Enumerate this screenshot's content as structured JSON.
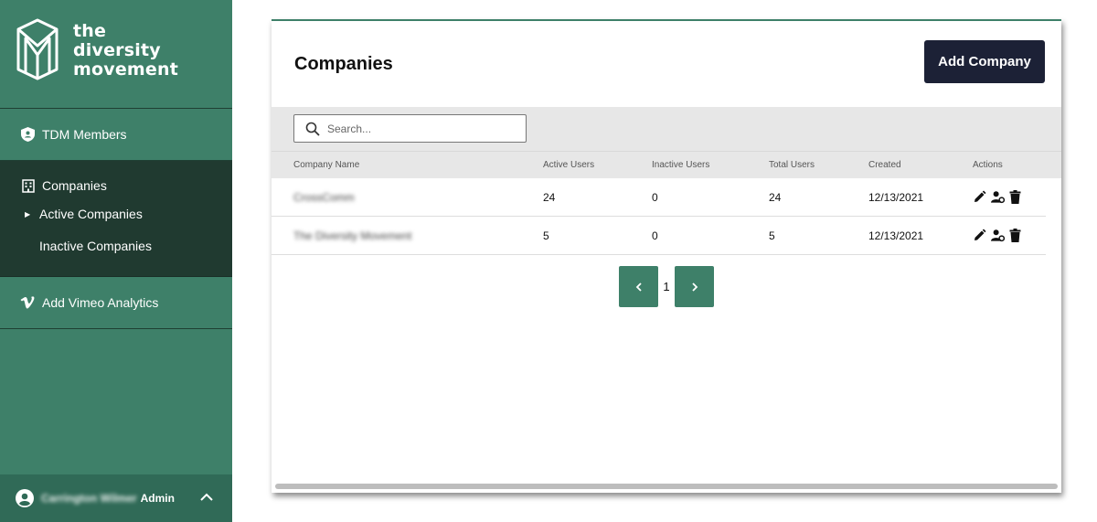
{
  "brand": {
    "line1": "the",
    "line2": "diversity",
    "line3": "movement",
    "color": "#3e8069"
  },
  "sidebar": {
    "tdm_members": "TDM Members",
    "companies": "Companies",
    "active_companies": "Active Companies",
    "inactive_companies": "Inactive Companies",
    "vimeo": "Add Vimeo Analytics",
    "user_name": "Carrington Wilmer",
    "user_role": "Admin"
  },
  "header": {
    "title": "Companies",
    "add_button": "Add Company"
  },
  "search": {
    "placeholder": "Search..."
  },
  "table": {
    "columns": [
      "Company Name",
      "Active Users",
      "Inactive Users",
      "Total Users",
      "Created",
      "Actions"
    ],
    "rows": [
      {
        "name": "CrossComm",
        "active": "24",
        "inactive": "0",
        "total": "24",
        "created": "12/13/2021"
      },
      {
        "name": "The Diversity Movement",
        "active": "5",
        "inactive": "0",
        "total": "5",
        "created": "12/13/2021"
      }
    ]
  },
  "pagination": {
    "current_page": "1"
  },
  "colors": {
    "sidebar": "#3e8069",
    "sidebar_active": "#203a30",
    "button_dark": "#1c2136"
  }
}
